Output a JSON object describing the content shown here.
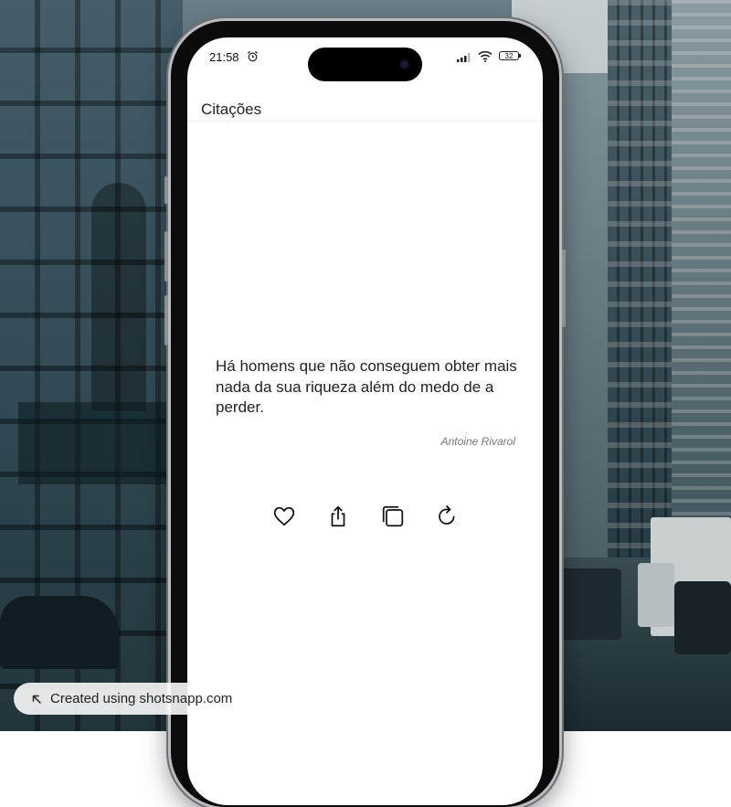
{
  "status_bar": {
    "time": "21:58",
    "battery": "32",
    "icons": [
      "alarm-icon",
      "signal-icon",
      "wifi-icon",
      "battery-icon"
    ]
  },
  "app_bar": {
    "title": "Citações"
  },
  "quote": {
    "text": "Há homens que não conseguem obter mais nada da sua riqueza além do medo de a perder.",
    "author": "Antoine Rivarol"
  },
  "actions": [
    {
      "name": "favorite",
      "icon": "heart-icon"
    },
    {
      "name": "share",
      "icon": "share-icon"
    },
    {
      "name": "copy",
      "icon": "copy-icon"
    },
    {
      "name": "refresh",
      "icon": "refresh-icon"
    }
  ],
  "watermark": {
    "text": "Created using shotsnapp.com",
    "icon": "arrow-up-left-icon"
  },
  "colors": {
    "screen_background": "#ffffff",
    "text_primary": "#222222",
    "text_secondary": "#777777",
    "phone_frame": "#0b0b0c"
  }
}
